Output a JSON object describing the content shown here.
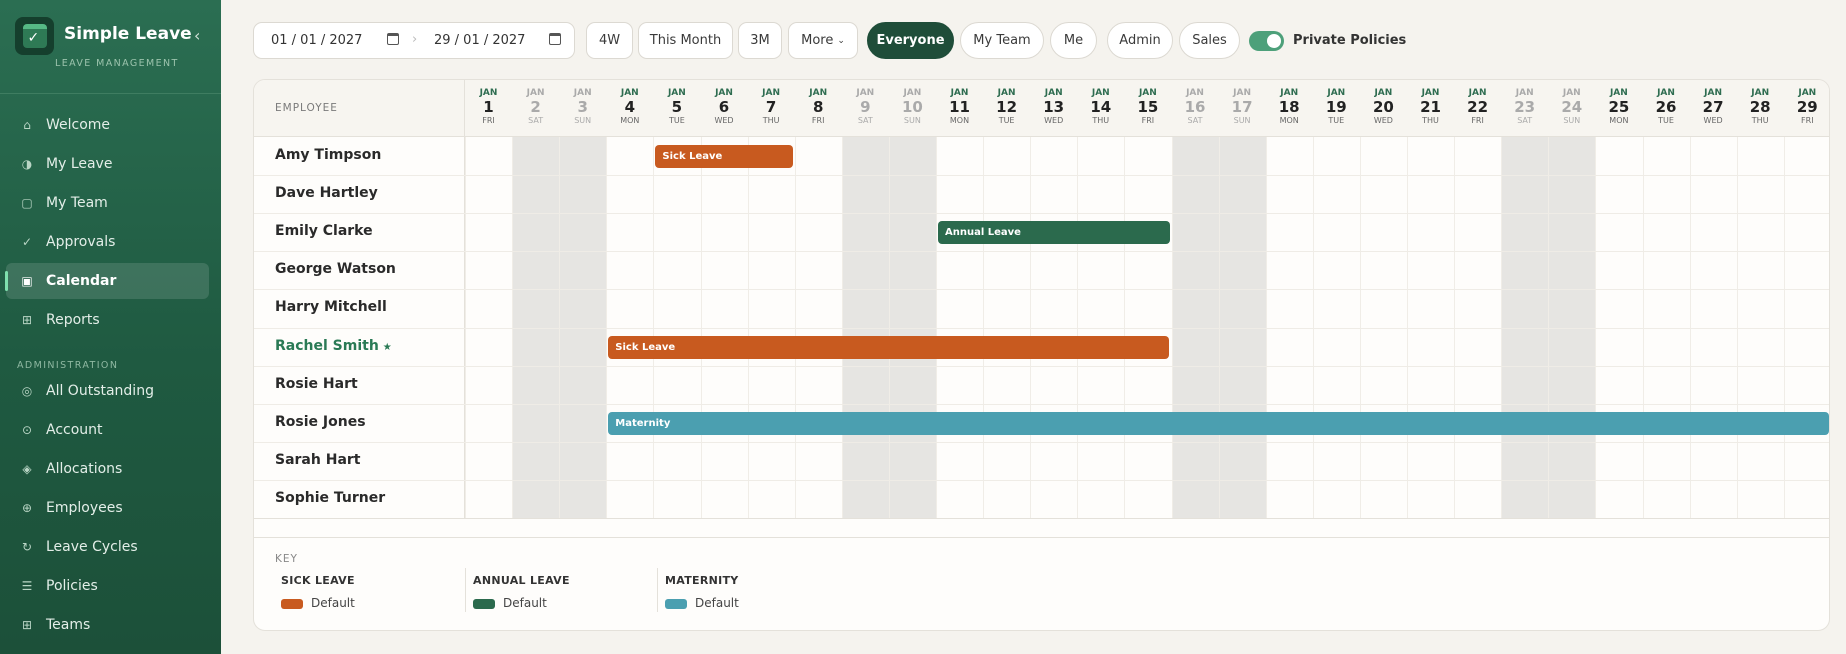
{
  "app": {
    "title": "Simple Leave",
    "subtitle": "LEAVE MANAGEMENT"
  },
  "nav": {
    "items": [
      {
        "label": "Welcome",
        "icon": "home-icon",
        "glyph": "⌂"
      },
      {
        "label": "My Leave",
        "icon": "half-circle-icon",
        "glyph": "◑"
      },
      {
        "label": "My Team",
        "icon": "square-icon",
        "glyph": "▢"
      },
      {
        "label": "Approvals",
        "icon": "check-icon",
        "glyph": "✓"
      },
      {
        "label": "Calendar",
        "icon": "calendar-icon",
        "glyph": "▣",
        "active": true
      },
      {
        "label": "Reports",
        "icon": "grid-icon",
        "glyph": "⊞"
      }
    ],
    "admin_heading": "ADMINISTRATION",
    "admin_items": [
      {
        "label": "All Outstanding",
        "icon": "target-icon",
        "glyph": "◎"
      },
      {
        "label": "Account",
        "icon": "circle-icon",
        "glyph": "⊙"
      },
      {
        "label": "Allocations",
        "icon": "diamond-icon",
        "glyph": "◈"
      },
      {
        "label": "Employees",
        "icon": "plus-circle-icon",
        "glyph": "⊕"
      },
      {
        "label": "Leave Cycles",
        "icon": "refresh-icon",
        "glyph": "↻"
      },
      {
        "label": "Policies",
        "icon": "list-icon",
        "glyph": "☰"
      },
      {
        "label": "Teams",
        "icon": "grid-icon",
        "glyph": "⊞"
      }
    ]
  },
  "toolbar": {
    "date_from": "01 / 01 / 2027",
    "date_to": "29 / 01 / 2027",
    "range_buttons": [
      "4W",
      "This Month",
      "3M",
      "More"
    ],
    "filters": [
      "Everyone",
      "My Team",
      "Me",
      "Admin",
      "Sales"
    ],
    "active_filter": "Everyone",
    "private_toggle_label": "Private Policies",
    "private_toggle_on": true
  },
  "calendar": {
    "employee_header": "EMPLOYEE",
    "days": [
      {
        "m": "JAN",
        "d": "1",
        "w": "FRI"
      },
      {
        "m": "JAN",
        "d": "2",
        "w": "SAT",
        "we": true
      },
      {
        "m": "JAN",
        "d": "3",
        "w": "SUN",
        "we": true
      },
      {
        "m": "JAN",
        "d": "4",
        "w": "MON"
      },
      {
        "m": "JAN",
        "d": "5",
        "w": "TUE"
      },
      {
        "m": "JAN",
        "d": "6",
        "w": "WED"
      },
      {
        "m": "JAN",
        "d": "7",
        "w": "THU"
      },
      {
        "m": "JAN",
        "d": "8",
        "w": "FRI"
      },
      {
        "m": "JAN",
        "d": "9",
        "w": "SAT",
        "we": true
      },
      {
        "m": "JAN",
        "d": "10",
        "w": "SUN",
        "we": true
      },
      {
        "m": "JAN",
        "d": "11",
        "w": "MON"
      },
      {
        "m": "JAN",
        "d": "12",
        "w": "TUE"
      },
      {
        "m": "JAN",
        "d": "13",
        "w": "WED"
      },
      {
        "m": "JAN",
        "d": "14",
        "w": "THU"
      },
      {
        "m": "JAN",
        "d": "15",
        "w": "FRI"
      },
      {
        "m": "JAN",
        "d": "16",
        "w": "SAT",
        "we": true
      },
      {
        "m": "JAN",
        "d": "17",
        "w": "SUN",
        "we": true
      },
      {
        "m": "JAN",
        "d": "18",
        "w": "MON"
      },
      {
        "m": "JAN",
        "d": "19",
        "w": "TUE"
      },
      {
        "m": "JAN",
        "d": "20",
        "w": "WED"
      },
      {
        "m": "JAN",
        "d": "21",
        "w": "THU"
      },
      {
        "m": "JAN",
        "d": "22",
        "w": "FRI"
      },
      {
        "m": "JAN",
        "d": "23",
        "w": "SAT",
        "we": true
      },
      {
        "m": "JAN",
        "d": "24",
        "w": "SUN",
        "we": true
      },
      {
        "m": "JAN",
        "d": "25",
        "w": "MON"
      },
      {
        "m": "JAN",
        "d": "26",
        "w": "TUE"
      },
      {
        "m": "JAN",
        "d": "27",
        "w": "WED"
      },
      {
        "m": "JAN",
        "d": "28",
        "w": "THU"
      },
      {
        "m": "JAN",
        "d": "29",
        "w": "FRI"
      }
    ],
    "employees": [
      "Amy Timpson",
      "Dave Hartley",
      "Emily Clarke",
      "George Watson",
      "Harry Mitchell",
      "Rachel Smith",
      "Rosie Hart",
      "Rosie Jones",
      "Sarah Hart",
      "Sophie Turner"
    ],
    "current_user_marker": "★",
    "leaves": [
      {
        "employee": "Amy Timpson",
        "type": "sick",
        "label": "Sick Leave",
        "start": "5",
        "end": "7"
      },
      {
        "employee": "Emily Clarke",
        "type": "annual",
        "label": "Annual Leave",
        "start": "11",
        "end": "15"
      },
      {
        "employee": "Rachel Smith",
        "type": "sick",
        "label": "Sick Leave",
        "start": "4",
        "end": "15"
      },
      {
        "employee": "Rosie Jones",
        "type": "mat",
        "label": "Maternity",
        "start": "4",
        "end": "29"
      }
    ]
  },
  "key": {
    "title": "KEY",
    "groups": [
      {
        "name": "SICK LEAVE",
        "label": "Default",
        "color": "#c85a1f"
      },
      {
        "name": "ANNUAL LEAVE",
        "label": "Default",
        "color": "#2b6a4d"
      },
      {
        "name": "MATERNITY",
        "label": "Default",
        "color": "#4b9fb0"
      }
    ]
  },
  "colors": {
    "sick": "#c85a1f",
    "annual": "#2b6a4d",
    "maternity": "#4b9fb0",
    "brand": "#1f4d39"
  }
}
